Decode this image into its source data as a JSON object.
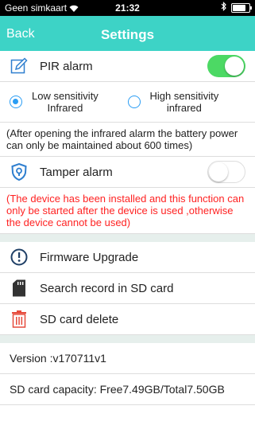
{
  "status_bar": {
    "carrier": "Geen simkaart",
    "time": "21:32",
    "battery_level": 0.9
  },
  "nav": {
    "back_label": "Back",
    "title": "Settings"
  },
  "pir": {
    "label": "PIR alarm",
    "enabled": true
  },
  "sensitivity": {
    "options": [
      "Low sensitivity\nInfrared",
      "High sensitivity\ninfrared"
    ],
    "selected": 0
  },
  "pir_note": "(After opening the infrared alarm the battery power can only be maintained about 600 times)",
  "tamper": {
    "label": "Tamper alarm",
    "enabled": false
  },
  "tamper_note": "(The device has been installed and this function can only be started after the device is used ,otherwise the device cannot be used)",
  "menu": {
    "firmware": "Firmware Upgrade",
    "search_sd": "Search record in SD card",
    "sd_delete": "SD card delete"
  },
  "info": {
    "version": "Version :v170711v1",
    "sd_capacity": "SD card capacity: Free7.49GB/Total7.50GB"
  },
  "colors": {
    "accent": "#3dd3c6",
    "toggle_on": "#4cd964",
    "radio": "#2a9df4",
    "warning": "#ff2222"
  }
}
